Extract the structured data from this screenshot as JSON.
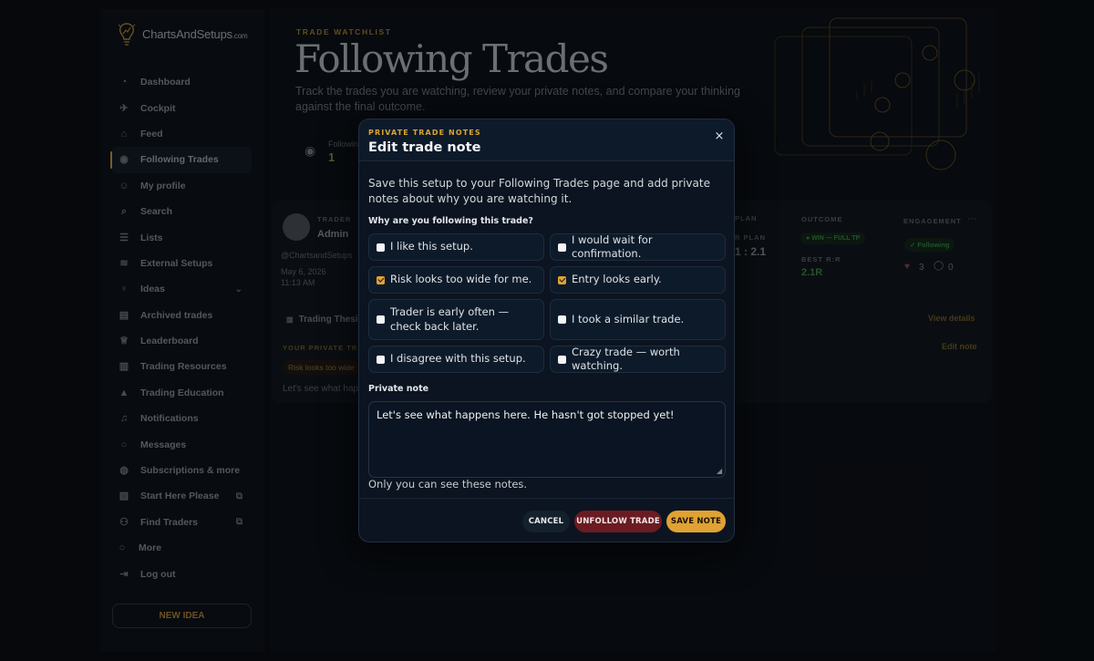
{
  "brand": {
    "name": "ChartsAndSetups",
    "suffix": ".com"
  },
  "sidebar": {
    "items": [
      {
        "label": "Dashboard",
        "icon": "dashboard-icon",
        "glyph": "◔"
      },
      {
        "label": "Cockpit",
        "icon": "cockpit-icon",
        "glyph": "✈"
      },
      {
        "label": "Feed",
        "icon": "home-icon",
        "glyph": "⌂"
      },
      {
        "label": "Following Trades",
        "icon": "eye-icon",
        "glyph": "◉"
      },
      {
        "label": "My profile",
        "icon": "user-icon",
        "glyph": "☺"
      },
      {
        "label": "Search",
        "icon": "search-icon",
        "glyph": "⌕"
      },
      {
        "label": "Lists",
        "icon": "list-icon",
        "glyph": "☰"
      },
      {
        "label": "External Setups",
        "icon": "stack-icon",
        "glyph": "≋"
      },
      {
        "label": "Ideas",
        "icon": "lightbulb-icon",
        "glyph": "♀"
      },
      {
        "label": "Archived trades",
        "icon": "archive-icon",
        "glyph": "▤"
      },
      {
        "label": "Leaderboard",
        "icon": "trophy-icon",
        "glyph": "♕"
      },
      {
        "label": "Trading Resources",
        "icon": "bar-chart-icon",
        "glyph": "▥"
      },
      {
        "label": "Trading Education",
        "icon": "graduation-icon",
        "glyph": "▲"
      },
      {
        "label": "Notifications",
        "icon": "bell-icon",
        "glyph": "♫"
      },
      {
        "label": "Messages",
        "icon": "chat-icon",
        "glyph": "○"
      },
      {
        "label": "Subscriptions & more",
        "icon": "globe-icon",
        "glyph": "◍"
      },
      {
        "label": "Start Here Please",
        "icon": "map-icon",
        "glyph": "▧"
      },
      {
        "label": "Find Traders",
        "icon": "users-icon",
        "glyph": "⚇"
      },
      {
        "label": "More",
        "icon": "more-circle-icon",
        "glyph": "○"
      },
      {
        "label": "Log out",
        "icon": "logout-icon",
        "glyph": "⇥"
      }
    ],
    "active": "Following Trades",
    "new_idea": "NEW IDEA"
  },
  "header": {
    "eyebrow": "TRADE WATCHLIST",
    "title": "Following Trades",
    "lede": "Track the trades you are watching, review your private notes, and compare your thinking against the final outcome.",
    "stat_label": "Following",
    "stat_value": "1"
  },
  "trade_card": {
    "trader_label": "TRADER",
    "trader_name": "Admin",
    "handle": "@ChartsandSetups",
    "date": "May 6, 2026",
    "time": "11:13 AM",
    "thesis_tab": "Trading Thesi",
    "plan_label": "PLAN",
    "rr_plan_label": "R PLAN",
    "rr_plan_value": "1 : 2.1",
    "outcome_label": "OUTCOME",
    "outcome_badge": "WIN — FULL TP",
    "best_rr_label": "BEST R:R",
    "best_rr_value": "2.1R",
    "engagement_label": "ENGAGEMENT",
    "following_badge": "Following",
    "likes": "3",
    "comments": "0",
    "view_details": "View details",
    "your_notes_label": "YOUR PRIVATE TRA",
    "tag": "Risk looks too wide",
    "note_preview": "Let's see what happ",
    "edit_note": "Edit note"
  },
  "modal": {
    "eyebrow": "PRIVATE TRADE NOTES",
    "title": "Edit trade note",
    "close": "×",
    "description": "Save this setup to your Following Trades page and add private notes about why you are watching it.",
    "question": "Why are you following this trade?",
    "options": [
      {
        "label": "I like this setup.",
        "checked": false
      },
      {
        "label": "I would wait for confirmation.",
        "checked": false
      },
      {
        "label": "Risk looks too wide for me.",
        "checked": true
      },
      {
        "label": "Entry looks early.",
        "checked": true
      },
      {
        "label": "Trader is early often — check back later.",
        "checked": false
      },
      {
        "label": "I took a similar trade.",
        "checked": false
      },
      {
        "label": "I disagree with this setup.",
        "checked": false
      },
      {
        "label": "Crazy trade — worth watching.",
        "checked": false
      }
    ],
    "private_note_label": "Private note",
    "private_note_value": "Let's see what happens here. He hasn't got stopped yet!",
    "private_note_help": "Only you can see these notes.",
    "buttons": {
      "cancel": "CANCEL",
      "unfollow": "UNFOLLOW TRADE",
      "save": "SAVE NOTE"
    }
  },
  "colors": {
    "accent": "#e0a233",
    "danger": "#6b1b22",
    "modal_bg": "#0b1420",
    "page_bg": "#080b10",
    "win": "#2f8a3e"
  }
}
